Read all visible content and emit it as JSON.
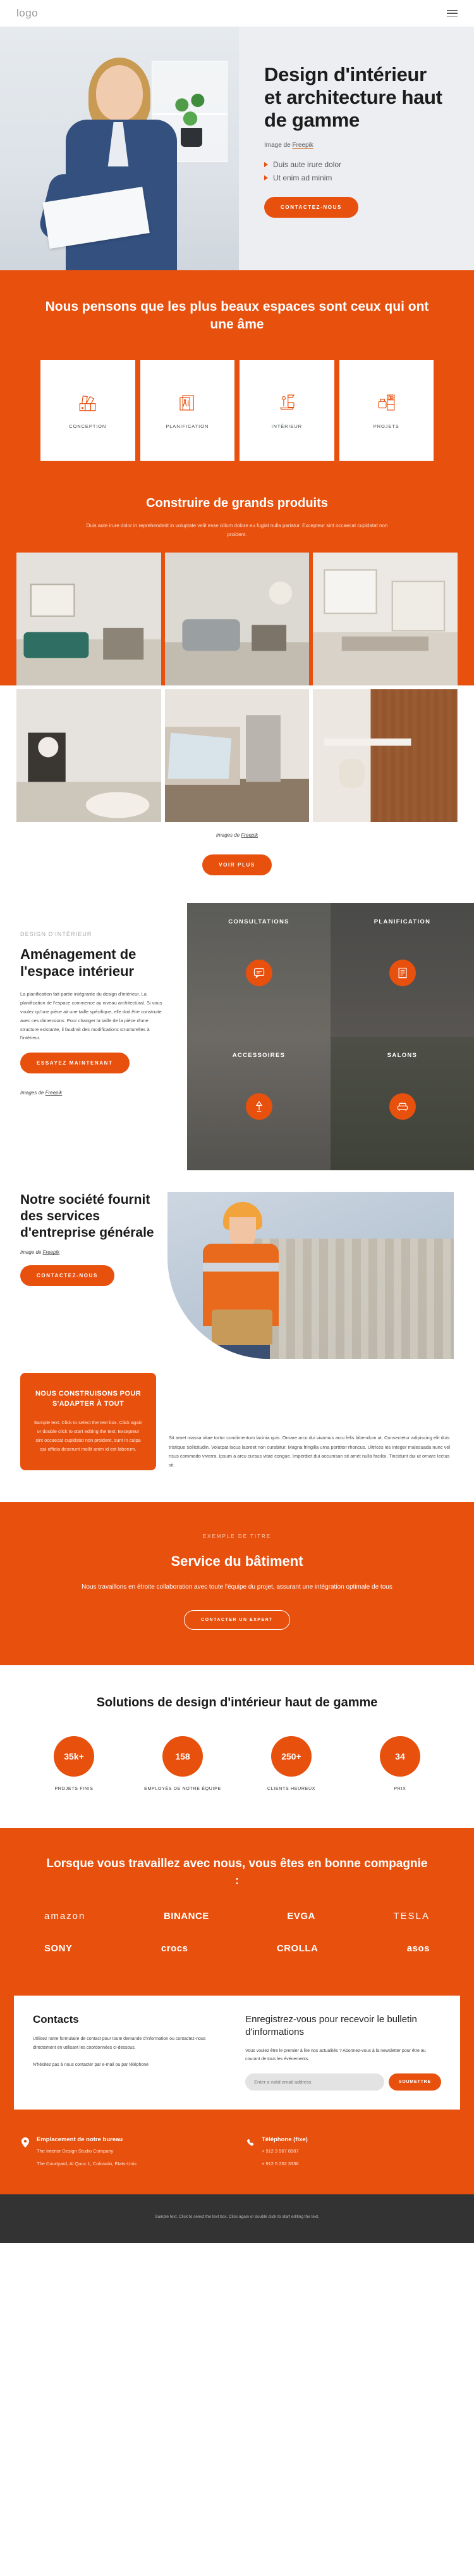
{
  "nav": {
    "logo": "logo",
    "menu_icon": "hamburger-icon"
  },
  "hero": {
    "title": "Design d'intérieur et architecture haut de gamme",
    "credit_prefix": "Image de ",
    "credit_link": "Freepik",
    "bullets": [
      "Duis aute irure dolor",
      "Ut enim ad minim"
    ],
    "cta": "CONTACTEZ-NOUS"
  },
  "banner": {
    "heading": "Nous pensons que les plus beaux espaces sont ceux qui ont une âme",
    "cards": [
      {
        "label": "CONCEPTION",
        "icon": "color-palette-icon"
      },
      {
        "label": "PLANIFICATION",
        "icon": "blueprint-tools-icon"
      },
      {
        "label": "INTÉRIEUR",
        "icon": "armchair-lamp-icon"
      },
      {
        "label": "PROJETS",
        "icon": "furniture-shelf-icon"
      }
    ]
  },
  "produits": {
    "heading": "Construire de grands produits",
    "subtext": "Duis aute irure dolor in reprehenderit in voluptate velit esse cillum dolore eu fugiat nulla pariatur. Excepteur sint occaecat cupidatat non proident.",
    "credit_prefix": "Images de ",
    "credit_link": "Freepik",
    "cta": "VOIR PLUS"
  },
  "amenagement": {
    "kicker": "DESIGN D'INTÉRIEUR",
    "title": "Aménagement de l'espace intérieur",
    "body": "La planification fait partie intégrante du design d'intérieur. La planification de l'espace commence au niveau architectural. Si vous voulez qu'une pièce ait une taille spécifique, elle doit être construite avec ces dimensions. Pour changer la taille de la pièce d'une structure existante, il faudrait des modifications structurelles à l'intérieur.",
    "cta": "ESSAYEZ MAINTENANT",
    "credit_prefix": "Images de ",
    "credit_link": "Freepik",
    "tiles": [
      {
        "label": "CONSULTATIONS",
        "icon": "chat-bubble-icon"
      },
      {
        "label": "PLANIFICATION",
        "icon": "document-plan-icon"
      },
      {
        "label": "ACCESSOIRES",
        "icon": "lamp-icon"
      },
      {
        "label": "SALONS",
        "icon": "sofa-icon"
      }
    ]
  },
  "societe": {
    "title": "Notre société fournit des services d'entreprise générale",
    "credit_prefix": "Image de ",
    "credit_link": "Freepik",
    "cta": "CONTACTEZ-NOUS",
    "callout_title": "NOUS CONSTRUISONS POUR S'ADAPTER À TOUT",
    "callout_body": "Sample text. Click to select the text box. Click again or double click to start editing the text. Excepteur sint occaecat cupidatat non proident, sunt in culpa qui officia deserunt mollit anim id est laborum.",
    "paragraph": "Sit amet massa vitae tortor condimentum lacinia quis. Ornare arcu dui vivamus arcu felis bibendum ut. Consectetur adipiscing elit duis tristique sollicitudin. Volutpat lacus laoreet non curabitur. Magna fringilla urna porttitor rhoncus. Ultrices les integer malesuada nunc vel risus commodo viverra. Ipsum a arcu cursus vitae congue. Imperdiet dui accumsan sit amet nulla facilisi. Tincidunt dui ut ornare lectus sit."
  },
  "service": {
    "kicker": "EXEMPLE DE TITRE",
    "title": "Service du bâtiment",
    "body": "Nous travaillons en étroite collaboration avec toute l'équipe du projet, assurant une intégration optimale de tous",
    "cta": "CONTACTER UN EXPERT"
  },
  "stats": {
    "heading": "Solutions de design d'intérieur haut de gamme",
    "items": [
      {
        "value": "35k+",
        "label": "PROJETS FINIS"
      },
      {
        "value": "158",
        "label": "EMPLOYÉS DE NOTRE ÉQUIPE"
      },
      {
        "value": "250+",
        "label": "CLIENTS HEUREUX"
      },
      {
        "value": "34",
        "label": "PRIX"
      }
    ]
  },
  "brands": {
    "heading": "Lorsque vous travaillez avec nous, vous êtes en bonne compagnie :",
    "row1": [
      "amazon",
      "BINANCE",
      "EVGA",
      "TESLA"
    ],
    "row2": [
      "SONY",
      "crocs",
      "CROLLA",
      "asos"
    ]
  },
  "contacts": {
    "title": "Contacts",
    "body1": "Utilisez notre formulaire de contact pour toute demande d'information ou contactez-nous directement en utilisant les coordonnées ci-dessous.",
    "body2": "N'hésitez pas à nous contacter par e-mail ou par téléphone",
    "newsletter_title": "Enregistrez-vous pour recevoir le bulletin d'informations",
    "newsletter_body": "Vous voulez être le premier à lire nos actualités ? Abonnez-vous à la newsletter pour être au courant de tous les événements.",
    "email_placeholder": "Enter a valid email address",
    "submit": "SOUMETTRE",
    "office_title": "Emplacement de notre bureau",
    "office_line1": "The Interior Design Studio Company",
    "office_line2": "The Courtyard, Al Quoz 1, Colorado,  États-Unis",
    "phone_title": "Téléphone (fixe)",
    "phone1": "+ 912 3 567 8987",
    "phone2": "+ 912 5 252 3336"
  },
  "footer": {
    "text": "Sample text. Click to select the text box. Click again or double click to start editing the text."
  },
  "colors": {
    "accent": "#e8500e",
    "dark": "#333333",
    "hero_bg": "#eceef1"
  }
}
